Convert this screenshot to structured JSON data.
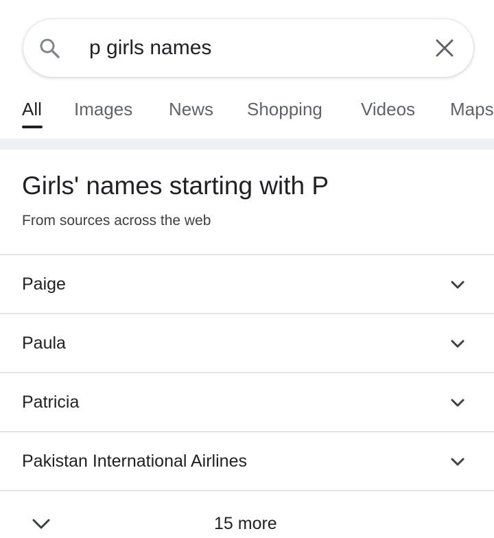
{
  "search": {
    "query": "p girls names",
    "search_icon": "search-icon",
    "clear_icon": "close-icon"
  },
  "tabs": [
    {
      "label": "All",
      "active": true
    },
    {
      "label": "Images",
      "active": false
    },
    {
      "label": "News",
      "active": false
    },
    {
      "label": "Shopping",
      "active": false
    },
    {
      "label": "Videos",
      "active": false
    },
    {
      "label": "Maps",
      "active": false
    }
  ],
  "card": {
    "title": "Girls' names starting with P",
    "subtitle": "From sources across the web",
    "items": [
      {
        "label": "Paige",
        "icon": "chevron-down-icon"
      },
      {
        "label": "Paula",
        "icon": "chevron-down-icon"
      },
      {
        "label": "Patricia",
        "icon": "chevron-down-icon"
      },
      {
        "label": "Pakistan International Airlines",
        "icon": "chevron-down-icon"
      }
    ],
    "more_label": "15 more",
    "more_icon": "chevron-down-icon"
  },
  "colors": {
    "text_primary": "#202124",
    "text_secondary": "#5f6368",
    "divider": "#e3e4e6",
    "band": "#eef0f3"
  }
}
